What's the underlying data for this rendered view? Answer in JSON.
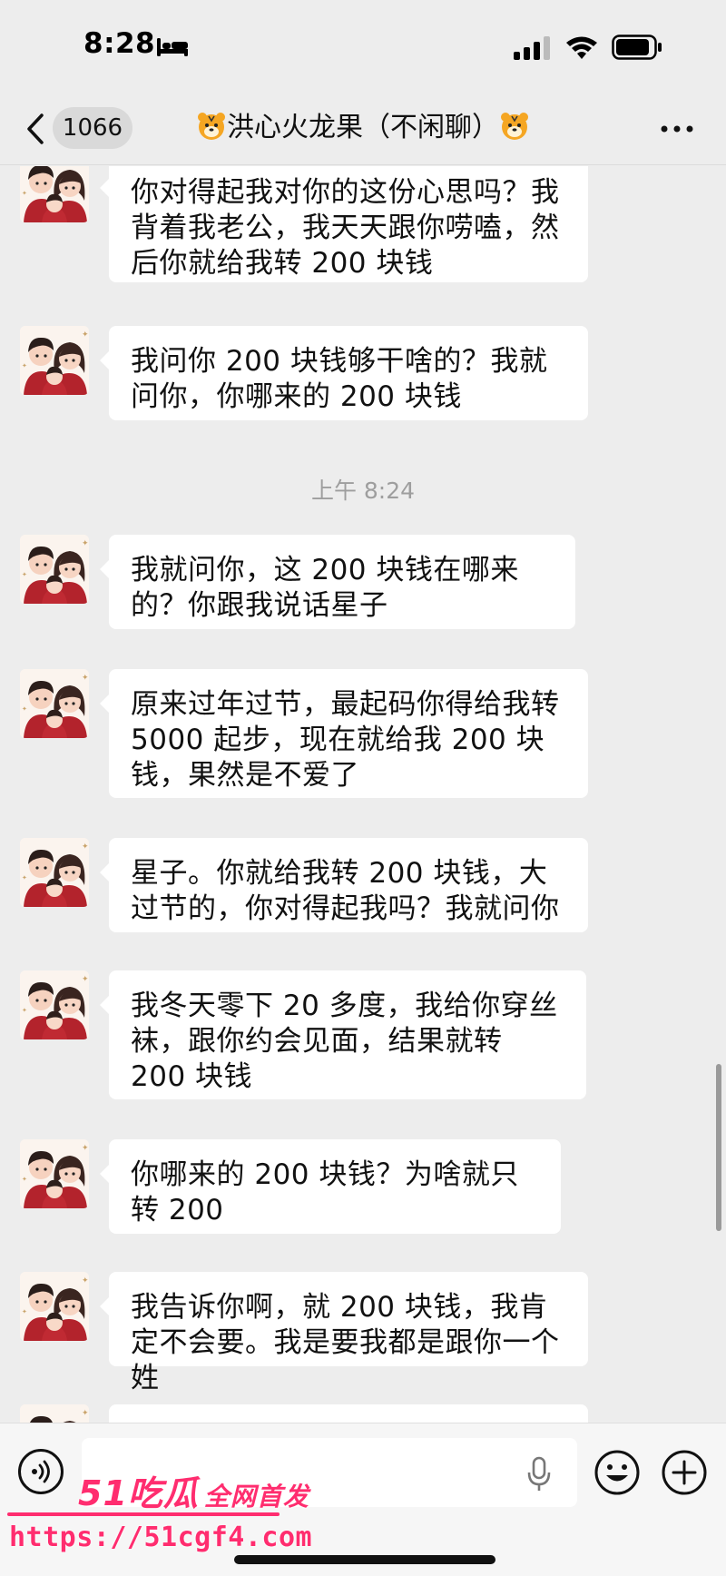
{
  "status_bar": {
    "time": "8:28"
  },
  "nav": {
    "unread_count": "1066",
    "chat_title": "洪心火龙果（不闲聊）",
    "title_icon": "tiger-face-emoji"
  },
  "messages": [
    {
      "text": "你对得起我对你的这份心思吗？我背着我老公，我天天跟你唠嗑，然后你就给我转 200 块钱"
    },
    {
      "text": "我问你 200 块钱够干啥的？我就问你，你哪来的 200 块钱"
    },
    {
      "text": "我就问你，这 200 块钱在哪来的？你跟我说话星子"
    },
    {
      "text": "原来过年过节，最起码你得给我转 5000 起步，现在就给我 200 块钱，果然是不爱了"
    },
    {
      "text": "星子。你就给我转 200 块钱，大过节的，你对得起我吗？我就问你"
    },
    {
      "text": "我冬天零下 20 多度，我给你穿丝袜，跟你约会见面，结果就转 200 块钱"
    },
    {
      "text": "你哪来的 200 块钱？为啥就只转 200"
    },
    {
      "text": "我告诉你啊，就 200 块钱，我肯定不会要。我是要我都是跟你一个姓"
    },
    {
      "text": ""
    }
  ],
  "time_divider": "上午 8:24",
  "input_bar": {
    "icons": [
      "voice-icon",
      "microphone-icon",
      "emoji-icon",
      "plus-icon"
    ]
  },
  "watermark": {
    "brand": "51吃瓜",
    "tagline": "全网首发",
    "url": "https://51cgf4.com"
  },
  "colors": {
    "background": "#ededed",
    "bubble": "#ffffff",
    "watermark": "#ff2d6f"
  }
}
